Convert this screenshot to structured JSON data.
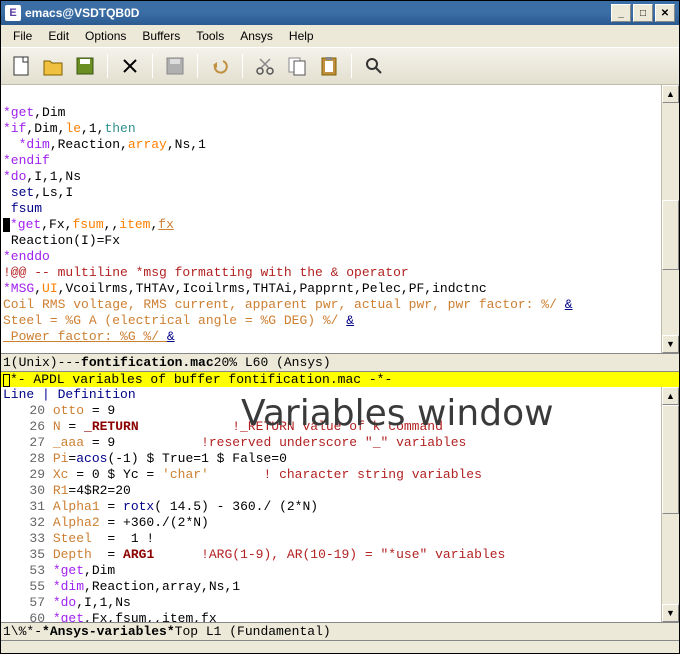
{
  "window": {
    "title": "emacs@VSDTQB0D"
  },
  "menu": {
    "items": [
      "File",
      "Edit",
      "Options",
      "Buffers",
      "Tools",
      "Ansys",
      "Help"
    ]
  },
  "toolbar": {
    "icons": [
      "new-file-icon",
      "open-icon",
      "save-icon",
      "close-icon",
      "save-disk-icon",
      "undo-icon",
      "cut-icon",
      "copy-icon",
      "paste-icon",
      "search-icon"
    ]
  },
  "code": {
    "l1a": "*get",
    "l1b": ",Dim",
    "l2a": "*if",
    "l2b": ",Dim,",
    "l2c": "le",
    "l2d": ",1,",
    "l2e": "then",
    "l3a": "*dim",
    "l3b": ",Reaction,",
    "l3c": "array",
    "l3d": ",Ns,1",
    "l4a": "*endif",
    "l5a": "*do",
    "l5b": ",I,1,Ns",
    "l6a": "set",
    "l6b": ",Ls,I",
    "l7a": "fsum",
    "l8a": "*get",
    "l8b": ",Fx,",
    "l8c": "fsum",
    "l8d": ",,",
    "l8e": "item",
    "l8f": ",",
    "l8g": "fx",
    "l9a": "Reaction(I)=Fx",
    "l10a": "*enddo",
    "l11a": "!@@ -- multiline *msg formatting with the & operator",
    "l12a": "*MSG",
    "l12b": ",",
    "l12c": "UI",
    "l12d": ",Vcoilrms,THTAv,Icoilrms,THTAi,Papprnt,Pelec,PF,indctnc",
    "l13a": "Coil RMS voltage, RMS current, apparent pwr, actual pwr, pwr factor: %/ ",
    "l13b": "&",
    "l14a": "Steel = %G A (electrical angle = %G DEG) %/ ",
    "l14b": "&",
    "l15a": " Power factor: %G %/ ",
    "l15b": "&"
  },
  "modeline1": {
    "left": "1(Unix)---  ",
    "file": "fontification.mac",
    "mid": "   20% L60    (Ansys)"
  },
  "banner": {
    "text": "*- APDL variables of buffer fontification.mac -*-"
  },
  "vars": {
    "header": "Line | Definition",
    "watermark": "Variables window",
    "rows": [
      {
        "n": "20",
        "v": "otto",
        "eq": " = 9"
      },
      {
        "n": "26",
        "v": "N",
        "eq": " = ",
        "sp": "_RETURN",
        "c": "            !_RETURN value of k command"
      },
      {
        "n": "27",
        "v": "_aaa",
        "eq": " = 9           ",
        "c": "!reserved underscore \"_\" variables"
      },
      {
        "n": "28",
        "v": "Pi",
        "eq": "=",
        "fn": "acos",
        "arg": "(-1) $ True=1 $ False=0"
      },
      {
        "n": "29",
        "v": "Xc",
        "eq": " = 0 $ Yc = ",
        "str": "'char'",
        "c": "       ! character string variables"
      },
      {
        "n": "30",
        "v": "R1",
        "eq": "=4$R2=20"
      },
      {
        "n": "31",
        "v": "Alpha1",
        "eq": " = ",
        "fn": "rotx",
        "arg": "( 14.5) - 360./ (2*N)"
      },
      {
        "n": "32",
        "v": "Alpha2",
        "eq": " = +360./(2*N)"
      },
      {
        "n": "33",
        "v": "Steel",
        "eq": "  =  1 !"
      },
      {
        "n": "35",
        "v": "Depth",
        "eq": "  = ",
        "sp": "ARG1",
        "c": "      !ARG(1-9), AR(10-19) = \"*use\" variables"
      },
      {
        "n": "53",
        "kw": "*get",
        "rest": ",Dim"
      },
      {
        "n": "55",
        "kw": "*dim",
        "rest": ",Reaction,array,Ns,1"
      },
      {
        "n": "57",
        "kw": "*do",
        "rest": ",I,1,Ns"
      },
      {
        "n": "60",
        "kw": "*get",
        "rest": ",Fx,fsum,,item,fx"
      }
    ]
  },
  "modeline2": {
    "left": "1\\%*-  ",
    "file": "*Ansys-variables*",
    "mid": "   Top L1     (Fundamental)"
  }
}
